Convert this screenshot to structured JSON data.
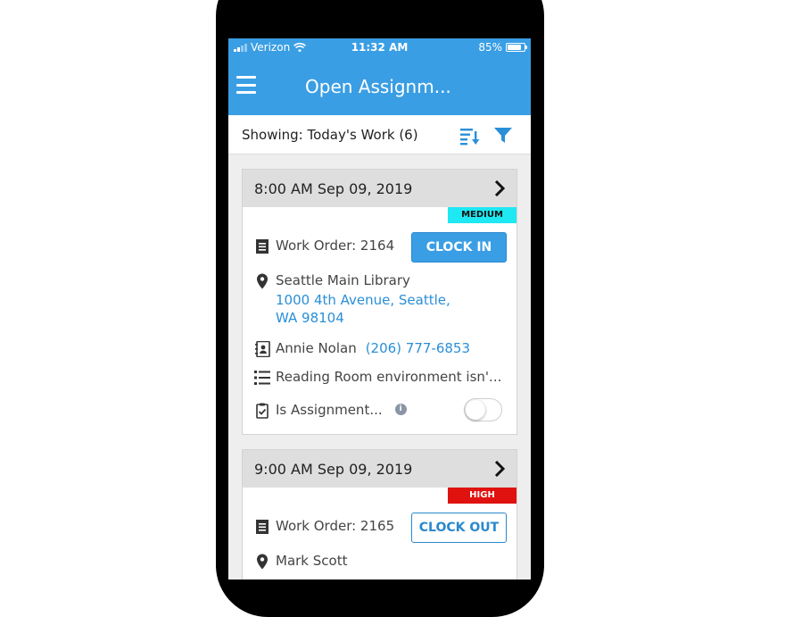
{
  "status_bar": {
    "carrier": "Verizon",
    "time": "11:32 AM",
    "battery": "85%"
  },
  "app_bar": {
    "title": "Open Assignm..."
  },
  "filter_bar": {
    "showing": "Showing: Today's Work (6)"
  },
  "assignments": [
    {
      "datetime": "8:00 AM Sep 09, 2019",
      "priority": "MEDIUM",
      "priority_color": "#1ee8f2",
      "work_order": "Work Order: 2164",
      "action": "CLOCK IN",
      "location_name": "Seattle Main Library",
      "address_line1": "1000 4th Avenue, Seattle,",
      "address_line2": "WA 98104",
      "contact_name": "Annie Nolan",
      "contact_phone": "(206) 777-6853",
      "description": "Reading Room environment isn'...",
      "assignment_flag": "Is Assignment..."
    },
    {
      "datetime": "9:00 AM Sep 09, 2019",
      "priority": "HIGH",
      "priority_color": "#e0120f",
      "work_order": "Work Order: 2165",
      "action": "CLOCK OUT",
      "location_name": "Mark Scott"
    }
  ],
  "colors": {
    "brand": "#3a9ee4",
    "link": "#2a8fd8"
  }
}
